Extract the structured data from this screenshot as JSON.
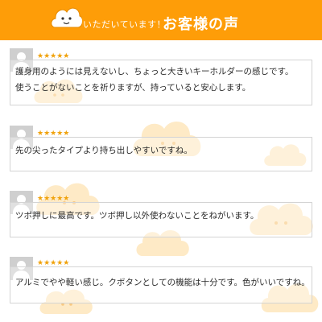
{
  "header": {
    "lead": "いただいています！",
    "title": "お客様の声"
  },
  "colors": {
    "header_bg": "#fe9d08",
    "star": "#f0a20c",
    "cloud": "#fde3b3"
  },
  "icons": {
    "mascot": "smiling-cloud-icon",
    "avatar": "user-silhouette-icon"
  },
  "reviews": [
    {
      "stars": "★★★★★",
      "lines": [
        "護身用のようには見えないし、ちょっと大きいキーホルダーの感じです。",
        "使うことがないことを祈りますが、持っていると安心します。"
      ]
    },
    {
      "stars": "★★★★★",
      "lines": [
        "先の尖ったタイプより持ち出しやすいですね。"
      ]
    },
    {
      "stars": "★★★★★",
      "lines": [
        "ツボ押しに最高です。ツボ押し以外使わないことをねがいます。"
      ]
    },
    {
      "stars": "★★★★★",
      "lines": [
        "アルミでやや軽い感じ。クボタンとしての機能は十分です。色がいいですね。"
      ]
    }
  ]
}
